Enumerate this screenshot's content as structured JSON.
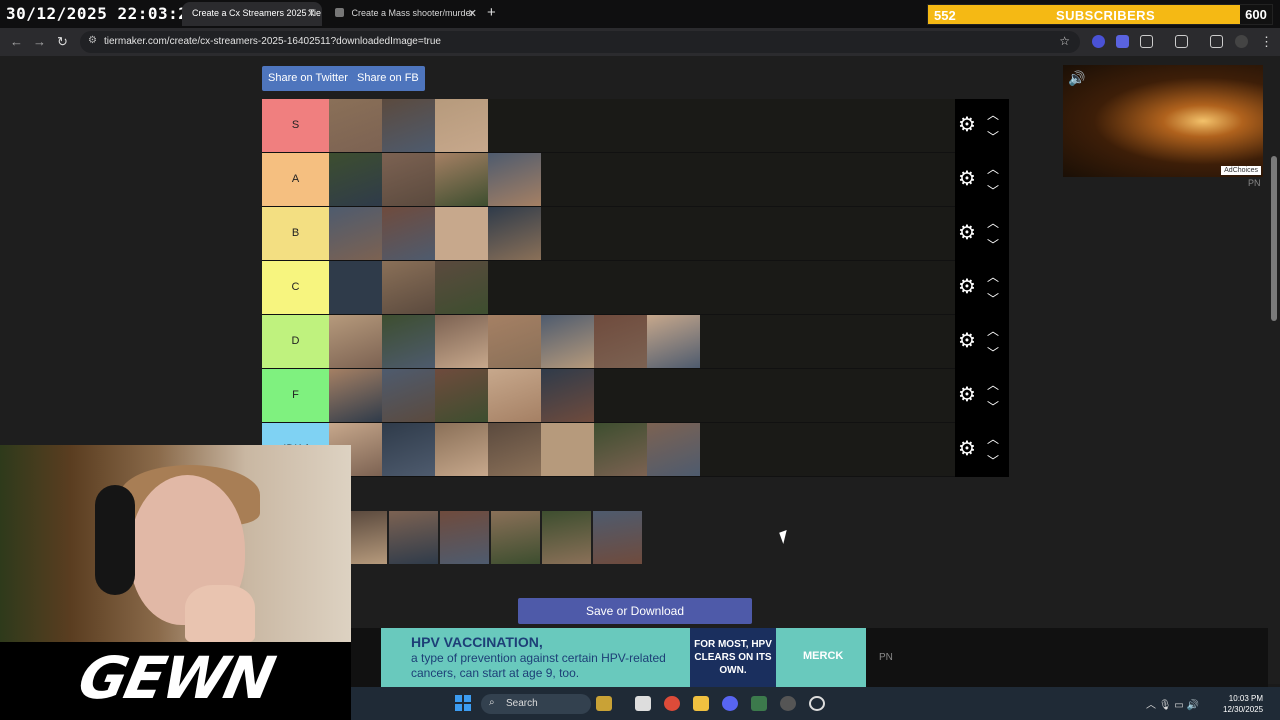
{
  "overlay": {
    "stream_date": "30/12/2025 22:03:25",
    "subs_current": "552",
    "subs_label": "SUBSCRIBERS",
    "subs_goal": "600",
    "streamer_logo": "GEWN"
  },
  "browser": {
    "tabs": [
      {
        "label": "Create a Cx Streamers 2025 Tie",
        "active": true
      },
      {
        "label": "Create a Mass shooter/murder",
        "active": false
      }
    ],
    "url": "tiermaker.com/create/cx-streamers-2025-16402511?downloadedImage=true",
    "icons": [
      "back-icon",
      "forward-icon",
      "reload-icon",
      "site-info-icon",
      "star-icon",
      "extensions-icon",
      "profile-icon",
      "menu-icon"
    ]
  },
  "page": {
    "share_twitter": "Share on Twitter",
    "share_fb": "Share on FB",
    "save_download": "Save or Download",
    "ad_choices": "AdChoices",
    "pn_label": "PN"
  },
  "tiers": [
    {
      "label": "S",
      "color": "#f07f7f",
      "items": 3
    },
    {
      "label": "A",
      "color": "#f5bf80",
      "items": 4
    },
    {
      "label": "B",
      "color": "#f3df82",
      "items": 4
    },
    {
      "label": "C",
      "color": "#f7f57f",
      "items": 3
    },
    {
      "label": "D",
      "color": "#bff27e",
      "items": 7
    },
    {
      "label": "F",
      "color": "#7ff17f",
      "items": 5
    },
    {
      "label": "IDK /",
      "color": "#7fd2f3",
      "items": 7
    }
  ],
  "pool_items": 6,
  "ad": {
    "title": "HPV VACCINATION,",
    "text": "a type of prevention against certain HPV-related cancers, can start at age 9, too.",
    "side": "FOR MOST, HPV CLEARS ON ITS OWN.",
    "brand": "MERCK"
  },
  "taskbar": {
    "search": "Search",
    "time": "10:03 PM",
    "date": "12/30/2025"
  }
}
